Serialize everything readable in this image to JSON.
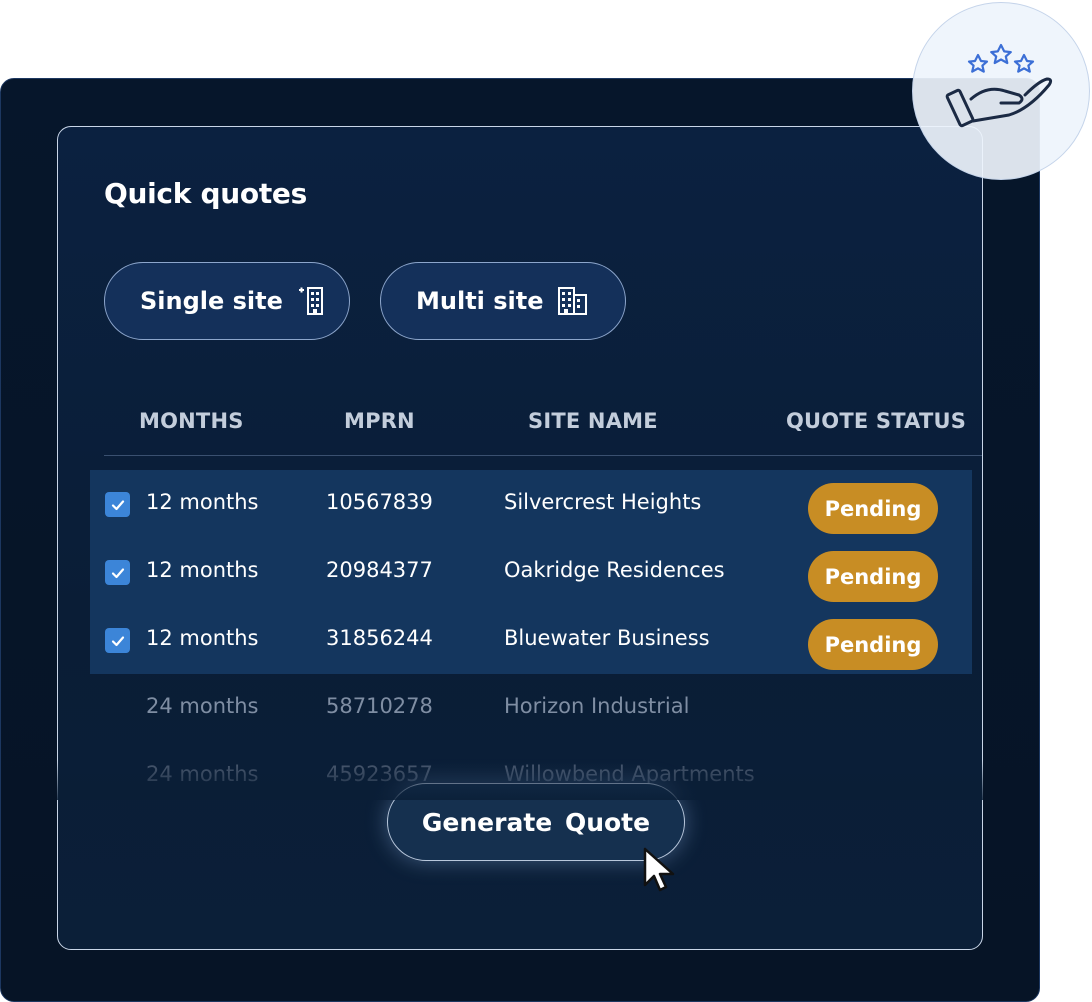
{
  "panel": {
    "title": "Quick quotes"
  },
  "actions": {
    "single_site_label": "Single site",
    "multi_site_label": "Multi site",
    "generate_label": "Generate  Quote"
  },
  "table": {
    "headers": [
      "MONTHS",
      "MPRN",
      "SITE NAME",
      "QUOTE STATUS"
    ],
    "rows": [
      {
        "months": "12 months",
        "mprn": "10567839",
        "site": "Silvercrest Heights",
        "status": "Pending",
        "checked": true
      },
      {
        "months": "12 months",
        "mprn": "20984377",
        "site": "Oakridge Residences",
        "status": "Pending",
        "checked": true
      },
      {
        "months": "12 months",
        "mprn": "31856244",
        "site": "Bluewater Business",
        "status": "Pending",
        "checked": true
      },
      {
        "months": "24 months",
        "mprn": "58710278",
        "site": "Horizon Industrial",
        "status": "",
        "checked": false
      },
      {
        "months": "24 months",
        "mprn": "45923657",
        "site": "Willowbend Apartments",
        "status": "",
        "checked": false
      }
    ]
  },
  "colors": {
    "pending_badge": "#c88d24",
    "checkbox": "#3c85d8",
    "selected_row": "#14365e",
    "panel_bg": "#0b2140"
  },
  "icons": {
    "single_site": "building-plus-icon",
    "multi_site": "buildings-icon",
    "checkbox": "check-icon",
    "cursor": "mouse-pointer-icon",
    "badge": "hand-stars-icon"
  }
}
